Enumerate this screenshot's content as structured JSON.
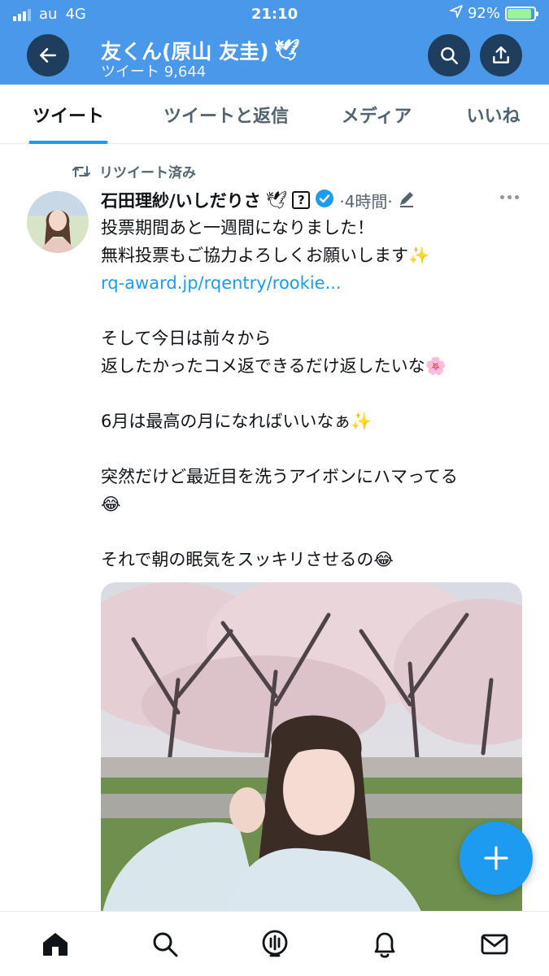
{
  "status_bar": {
    "carrier": "au",
    "network": "4G",
    "time": "21:10",
    "battery": "92%"
  },
  "profile": {
    "name": "友くん(原山 友圭)",
    "name_emoji": "🕊",
    "tweet_count_label": "ツイート 9,644"
  },
  "tabs": [
    {
      "label": "ツイート",
      "active": true
    },
    {
      "label": "ツイートと返信",
      "active": false
    },
    {
      "label": "メディア",
      "active": false
    },
    {
      "label": "いいね",
      "active": false
    }
  ],
  "tweet": {
    "retweet_label": "リツイート済み",
    "author_name": "石田理紗/いしだりさ",
    "author_emoji": "🕊",
    "badge_glyph": "?",
    "meta": "·4時間·",
    "lines": [
      "投票期間あと一週間になりました！",
      "無料投票もご協力よろしくお願いします✨",
      "rq-award.jp/rqentry/rookie...",
      "",
      "そして今日は前々から",
      "返したかったコメ返できるだけ返したいな🌸",
      "",
      "6月は最高の月になればいいなぁ✨",
      "",
      "突然だけど最近目を洗うアイボンにハマってる",
      "😂",
      "",
      "それで朝の眠気をスッキリさせるの😂"
    ]
  },
  "colors": {
    "header_bg": "#4a98e9",
    "accent": "#1d9bf0",
    "text_primary": "#0f1419",
    "text_secondary": "#536471"
  },
  "icons": {
    "back": "back-arrow-icon",
    "search": "search-icon",
    "share": "share-icon",
    "retweet": "retweet-icon",
    "verified": "verified-badge-icon",
    "edit": "edit-icon",
    "more": "more-icon",
    "compose": "plus-icon",
    "nav": [
      "home-icon",
      "search-icon",
      "spaces-icon",
      "notifications-icon",
      "messages-icon"
    ]
  }
}
